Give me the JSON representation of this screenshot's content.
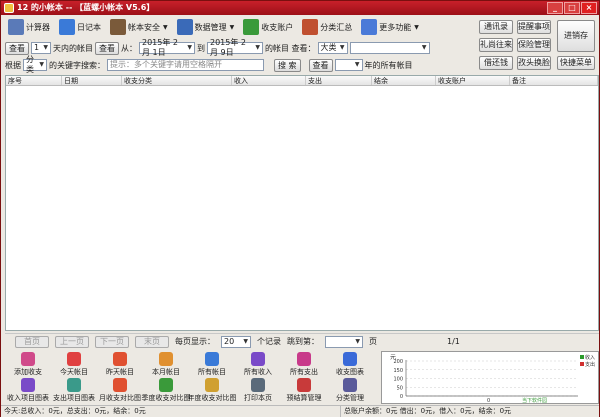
{
  "window": {
    "title": "12 的小帐本 -- 【蓝螺小帐本 V5.6】",
    "min": "_",
    "max": "□",
    "close": "×"
  },
  "toolbar": [
    {
      "label": "计算器",
      "icon": "calculator-icon",
      "color": "#5a7ab8",
      "dd": false
    },
    {
      "label": "日记本",
      "icon": "notebook-icon",
      "color": "#3a7ad8",
      "dd": false
    },
    {
      "label": "帐本安全",
      "icon": "ledger-security-icon",
      "color": "#7a5a3a",
      "dd": true
    },
    {
      "label": "数据管理",
      "icon": "data-management-icon",
      "color": "#3a6ab8",
      "dd": true
    },
    {
      "label": "收支账户",
      "icon": "account-icon",
      "color": "#3a9a3a",
      "dd": false
    },
    {
      "label": "分类汇总",
      "icon": "category-summary-icon",
      "color": "#c05030",
      "dd": false
    },
    {
      "label": "更多功能",
      "icon": "more-functions-icon",
      "color": "#4a7ad8",
      "dd": true
    }
  ],
  "filter1": {
    "view_btn": "查看",
    "day_count": "1",
    "days_text": "天内的帐目",
    "view_btn2": "查看",
    "from_text": "从：",
    "from_date": "2015年 2月 1日",
    "to_text": "到",
    "to_date": "2015年 2月 9日",
    "ledger_text": "的帐目 查看：",
    "category_sel": "大类",
    "sub_sel": ""
  },
  "filter2": {
    "by_text": "根据",
    "field_sel": "分类",
    "keyword_text": "的关键字搜索：",
    "search_placeholder": "提示：多个关键字请用空格隔开",
    "search_btn": "搜 索",
    "view_btn": "查看",
    "year_sel": "",
    "year_text": "年的所有帐目"
  },
  "right_buttons": [
    "通讯录",
    "提醒事项",
    "礼尚往来",
    "保险管理",
    "借还钱",
    "孜头换脸",
    "进销存",
    "快捷菜单"
  ],
  "grid": {
    "columns": [
      "序号",
      "日期",
      "收支分类",
      "收入",
      "支出",
      "结余",
      "收支账户",
      "备注"
    ]
  },
  "pager": {
    "first": "首页",
    "prev": "上一页",
    "next": "下一页",
    "last": "末页",
    "per_page_label": "每页显示：",
    "per_page": "20",
    "records_label": "个记录",
    "jump_label": "跳到第：",
    "jump_sel": "",
    "page_label": "页",
    "page_info": "1/1"
  },
  "quick_actions": [
    {
      "label": "添加收支",
      "icon": "add-entry-icon",
      "color": "#d04a8a"
    },
    {
      "label": "今天帐目",
      "icon": "today-icon",
      "color": "#e04040"
    },
    {
      "label": "昨天帐目",
      "icon": "yesterday-icon",
      "color": "#e05030"
    },
    {
      "label": "本月帐目",
      "icon": "month-icon",
      "color": "#e09030"
    },
    {
      "label": "所有帐目",
      "icon": "all-entries-icon",
      "color": "#3a7ad8"
    },
    {
      "label": "所有收入",
      "icon": "all-income-icon",
      "color": "#7a4ac8"
    },
    {
      "label": "所有支出",
      "icon": "all-expense-icon",
      "color": "#c83a8a"
    },
    {
      "label": "收支图表",
      "icon": "chart-icon",
      "color": "#3a6ad8"
    },
    {
      "label": "收入项目图表",
      "icon": "income-chart-icon",
      "color": "#7a4ac8"
    },
    {
      "label": "支出项目图表",
      "icon": "expense-chart-icon",
      "color": "#3a9a8a"
    },
    {
      "label": "月收支对比图",
      "icon": "monthly-compare-icon",
      "color": "#e05030"
    },
    {
      "label": "季度收支对比图",
      "icon": "quarterly-compare-icon",
      "color": "#3a9a3a"
    },
    {
      "label": "年度收支对比图",
      "icon": "yearly-compare-icon",
      "color": "#d0a030"
    },
    {
      "label": "打印本页",
      "icon": "print-icon",
      "color": "#5a6a7a"
    },
    {
      "label": "预结算管理",
      "icon": "settlement-icon",
      "color": "#c83a3a"
    },
    {
      "label": "分类管理",
      "icon": "category-management-icon",
      "color": "#5a5a9a"
    }
  ],
  "mini_chart": {
    "unit": "元",
    "ticks": [
      "200",
      "150",
      "100",
      "50",
      "0"
    ],
    "legend": [
      {
        "name": "收入",
        "color": "#2a9a2a"
      },
      {
        "name": "支出",
        "color": "#d03030"
      }
    ],
    "zero_label": "0",
    "watermark": "当下软件园"
  },
  "status": {
    "left": "今天:总收入：0元，总支出：0元，结余：0元",
    "right": "总账户余额：0元 借出：0元，借入：0元，结余：0元"
  }
}
